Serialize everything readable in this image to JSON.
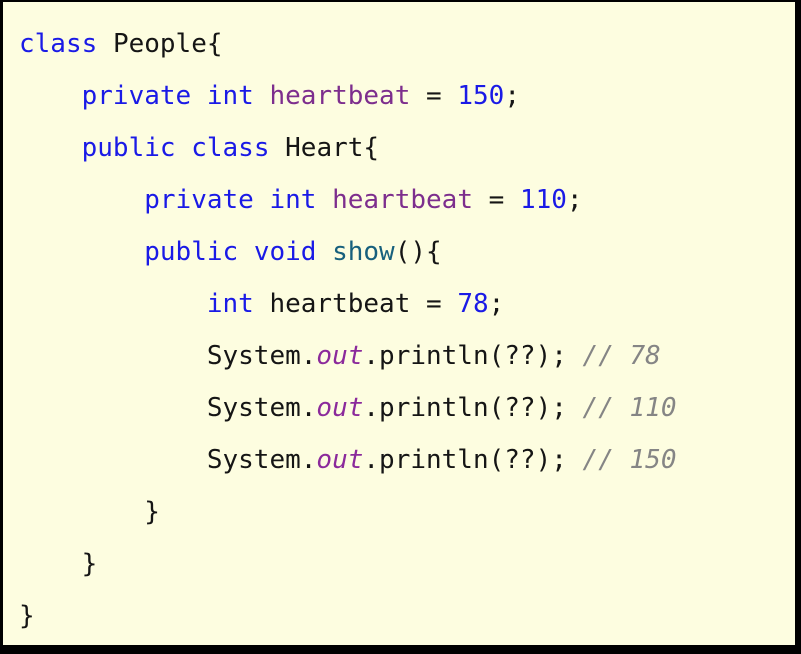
{
  "editor": {
    "background_color": "#FDFDE0",
    "border_color": "#000000",
    "language": "java",
    "font_size_px": 26,
    "line_height_px": 52
  },
  "palette": {
    "keyword": "#1A1AE6",
    "number": "#1A1AE6",
    "field": "#7D2E8D",
    "static_field": "#8B2A9B",
    "method": "#17607D",
    "plain": "#151515",
    "comment": "#858585"
  },
  "code": {
    "lines": [
      {
        "indent": 0,
        "tokens": [
          {
            "text": "class",
            "style": "kw"
          },
          {
            "text": " ",
            "style": "plain"
          },
          {
            "text": "People{",
            "style": "plain"
          }
        ]
      },
      {
        "indent": 1,
        "tokens": [
          {
            "text": "private",
            "style": "kw"
          },
          {
            "text": " ",
            "style": "plain"
          },
          {
            "text": "int",
            "style": "kw"
          },
          {
            "text": " ",
            "style": "plain"
          },
          {
            "text": "heartbeat",
            "style": "field"
          },
          {
            "text": " = ",
            "style": "plain"
          },
          {
            "text": "150",
            "style": "num"
          },
          {
            "text": ";",
            "style": "plain"
          }
        ]
      },
      {
        "indent": 1,
        "tokens": [
          {
            "text": "public",
            "style": "kw"
          },
          {
            "text": " ",
            "style": "plain"
          },
          {
            "text": "class",
            "style": "kw"
          },
          {
            "text": " ",
            "style": "plain"
          },
          {
            "text": "Heart{",
            "style": "plain"
          }
        ]
      },
      {
        "indent": 2,
        "tokens": [
          {
            "text": "private",
            "style": "kw"
          },
          {
            "text": " ",
            "style": "plain"
          },
          {
            "text": "int",
            "style": "kw"
          },
          {
            "text": " ",
            "style": "plain"
          },
          {
            "text": "heartbeat",
            "style": "field"
          },
          {
            "text": " = ",
            "style": "plain"
          },
          {
            "text": "110",
            "style": "num"
          },
          {
            "text": ";",
            "style": "plain"
          }
        ]
      },
      {
        "indent": 2,
        "tokens": [
          {
            "text": "public",
            "style": "kw"
          },
          {
            "text": " ",
            "style": "plain"
          },
          {
            "text": "void",
            "style": "kw"
          },
          {
            "text": " ",
            "style": "plain"
          },
          {
            "text": "show",
            "style": "method"
          },
          {
            "text": "(){",
            "style": "plain"
          }
        ]
      },
      {
        "indent": 3,
        "tokens": [
          {
            "text": "int",
            "style": "kw"
          },
          {
            "text": " ",
            "style": "plain"
          },
          {
            "text": "heartbeat",
            "style": "plain"
          },
          {
            "text": " = ",
            "style": "plain"
          },
          {
            "text": "78",
            "style": "num"
          },
          {
            "text": ";",
            "style": "plain"
          }
        ]
      },
      {
        "indent": 3,
        "tokens": [
          {
            "text": "System.",
            "style": "plain"
          },
          {
            "text": "out",
            "style": "static"
          },
          {
            "text": ".println(??); ",
            "style": "plain"
          },
          {
            "text": "// 78",
            "style": "comment"
          }
        ]
      },
      {
        "indent": 3,
        "tokens": [
          {
            "text": "System.",
            "style": "plain"
          },
          {
            "text": "out",
            "style": "static"
          },
          {
            "text": ".println(??); ",
            "style": "plain"
          },
          {
            "text": "// 110",
            "style": "comment"
          }
        ]
      },
      {
        "indent": 3,
        "tokens": [
          {
            "text": "System.",
            "style": "plain"
          },
          {
            "text": "out",
            "style": "static"
          },
          {
            "text": ".println(??); ",
            "style": "plain"
          },
          {
            "text": "// 150",
            "style": "comment"
          }
        ]
      },
      {
        "indent": 2,
        "tokens": [
          {
            "text": "}",
            "style": "plain"
          }
        ]
      },
      {
        "indent": 1,
        "tokens": [
          {
            "text": "}",
            "style": "plain"
          }
        ]
      },
      {
        "indent": 0,
        "tokens": [
          {
            "text": "}",
            "style": "plain"
          }
        ]
      }
    ]
  }
}
